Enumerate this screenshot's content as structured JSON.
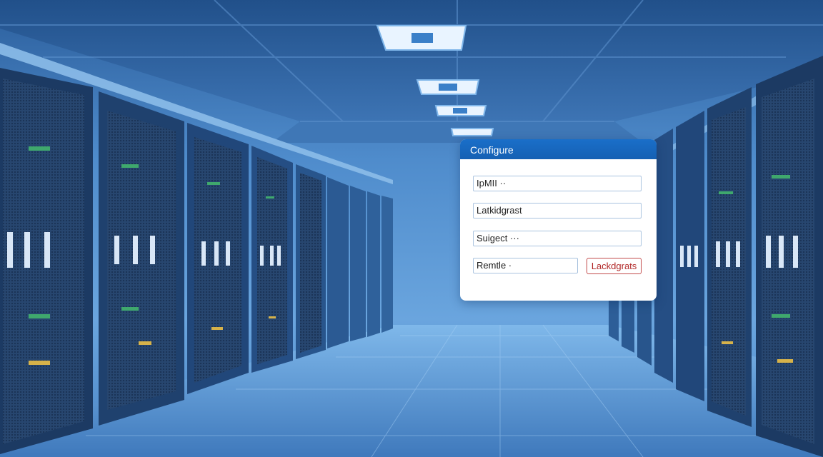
{
  "dialog": {
    "title": "Configure",
    "fields": [
      {
        "value": "IpMII ··"
      },
      {
        "value": "Latkidgrast"
      },
      {
        "value": "Suigect ···"
      },
      {
        "value": "Remtle ·"
      }
    ],
    "action_button": "Lackdgrats"
  },
  "colors": {
    "header": "#1a6fc9",
    "button_border": "#c24a4a",
    "button_text": "#b22a2a",
    "field_border": "#a9c3df"
  }
}
